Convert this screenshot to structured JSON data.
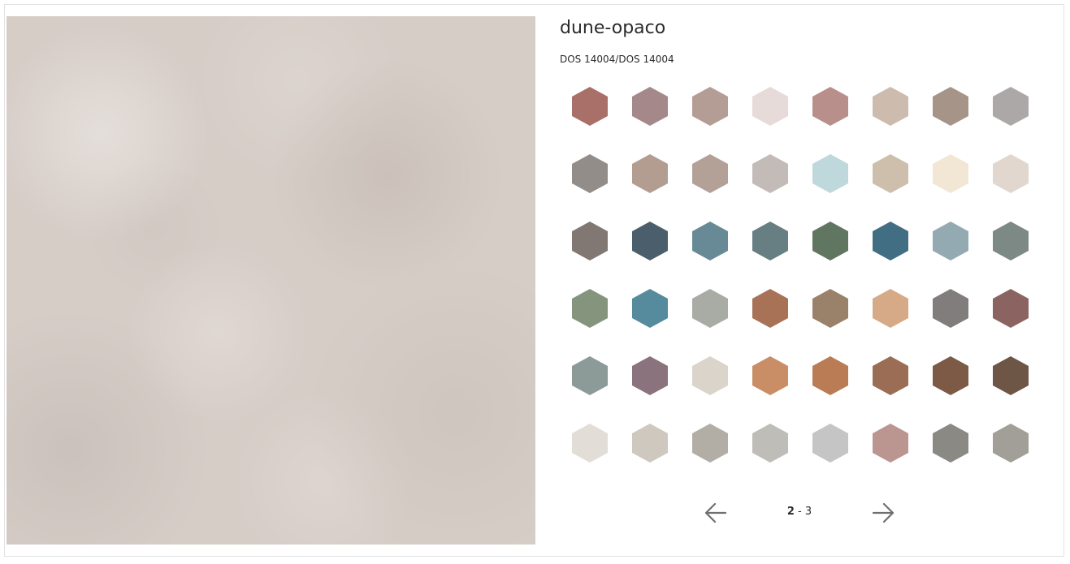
{
  "product": {
    "name": "dune-opaco",
    "code": "DOS 14004/DOS 14004"
  },
  "swatches": [
    "#a9706a",
    "#a4888a",
    "#b49d94",
    "#e6dbd8",
    "#b98f8b",
    "#cdbcae",
    "#a79489",
    "#aca8a8",
    "#928d89",
    "#b39d91",
    "#b3a096",
    "#c3bbb8",
    "#bed8db",
    "#cebfad",
    "#f2e6d5",
    "#e2d7ce",
    "#817874",
    "#4a5f6b",
    "#678a96",
    "#677f82",
    "#607661",
    "#426e83",
    "#93aab3",
    "#7d8985",
    "#85957d",
    "#568b9d",
    "#a9aba5",
    "#a77256",
    "#9a826a",
    "#d6aa87",
    "#817d7c",
    "#8b6462",
    "#8c9a98",
    "#8a737c",
    "#dbd4ca",
    "#c98e66",
    "#b97c55",
    "#9a6d54",
    "#7c5a45",
    "#6e5647",
    "#e3ddd8",
    "#cec8bf",
    "#b2aea6",
    "#bfbdb8",
    "#c5c5c5",
    "#bb9590",
    "#8a8983",
    "#a29f98"
  ],
  "pagination": {
    "current": "2",
    "separator": " - ",
    "total": "3",
    "prev_icon": "arrow-left-icon",
    "next_icon": "arrow-right-icon"
  }
}
